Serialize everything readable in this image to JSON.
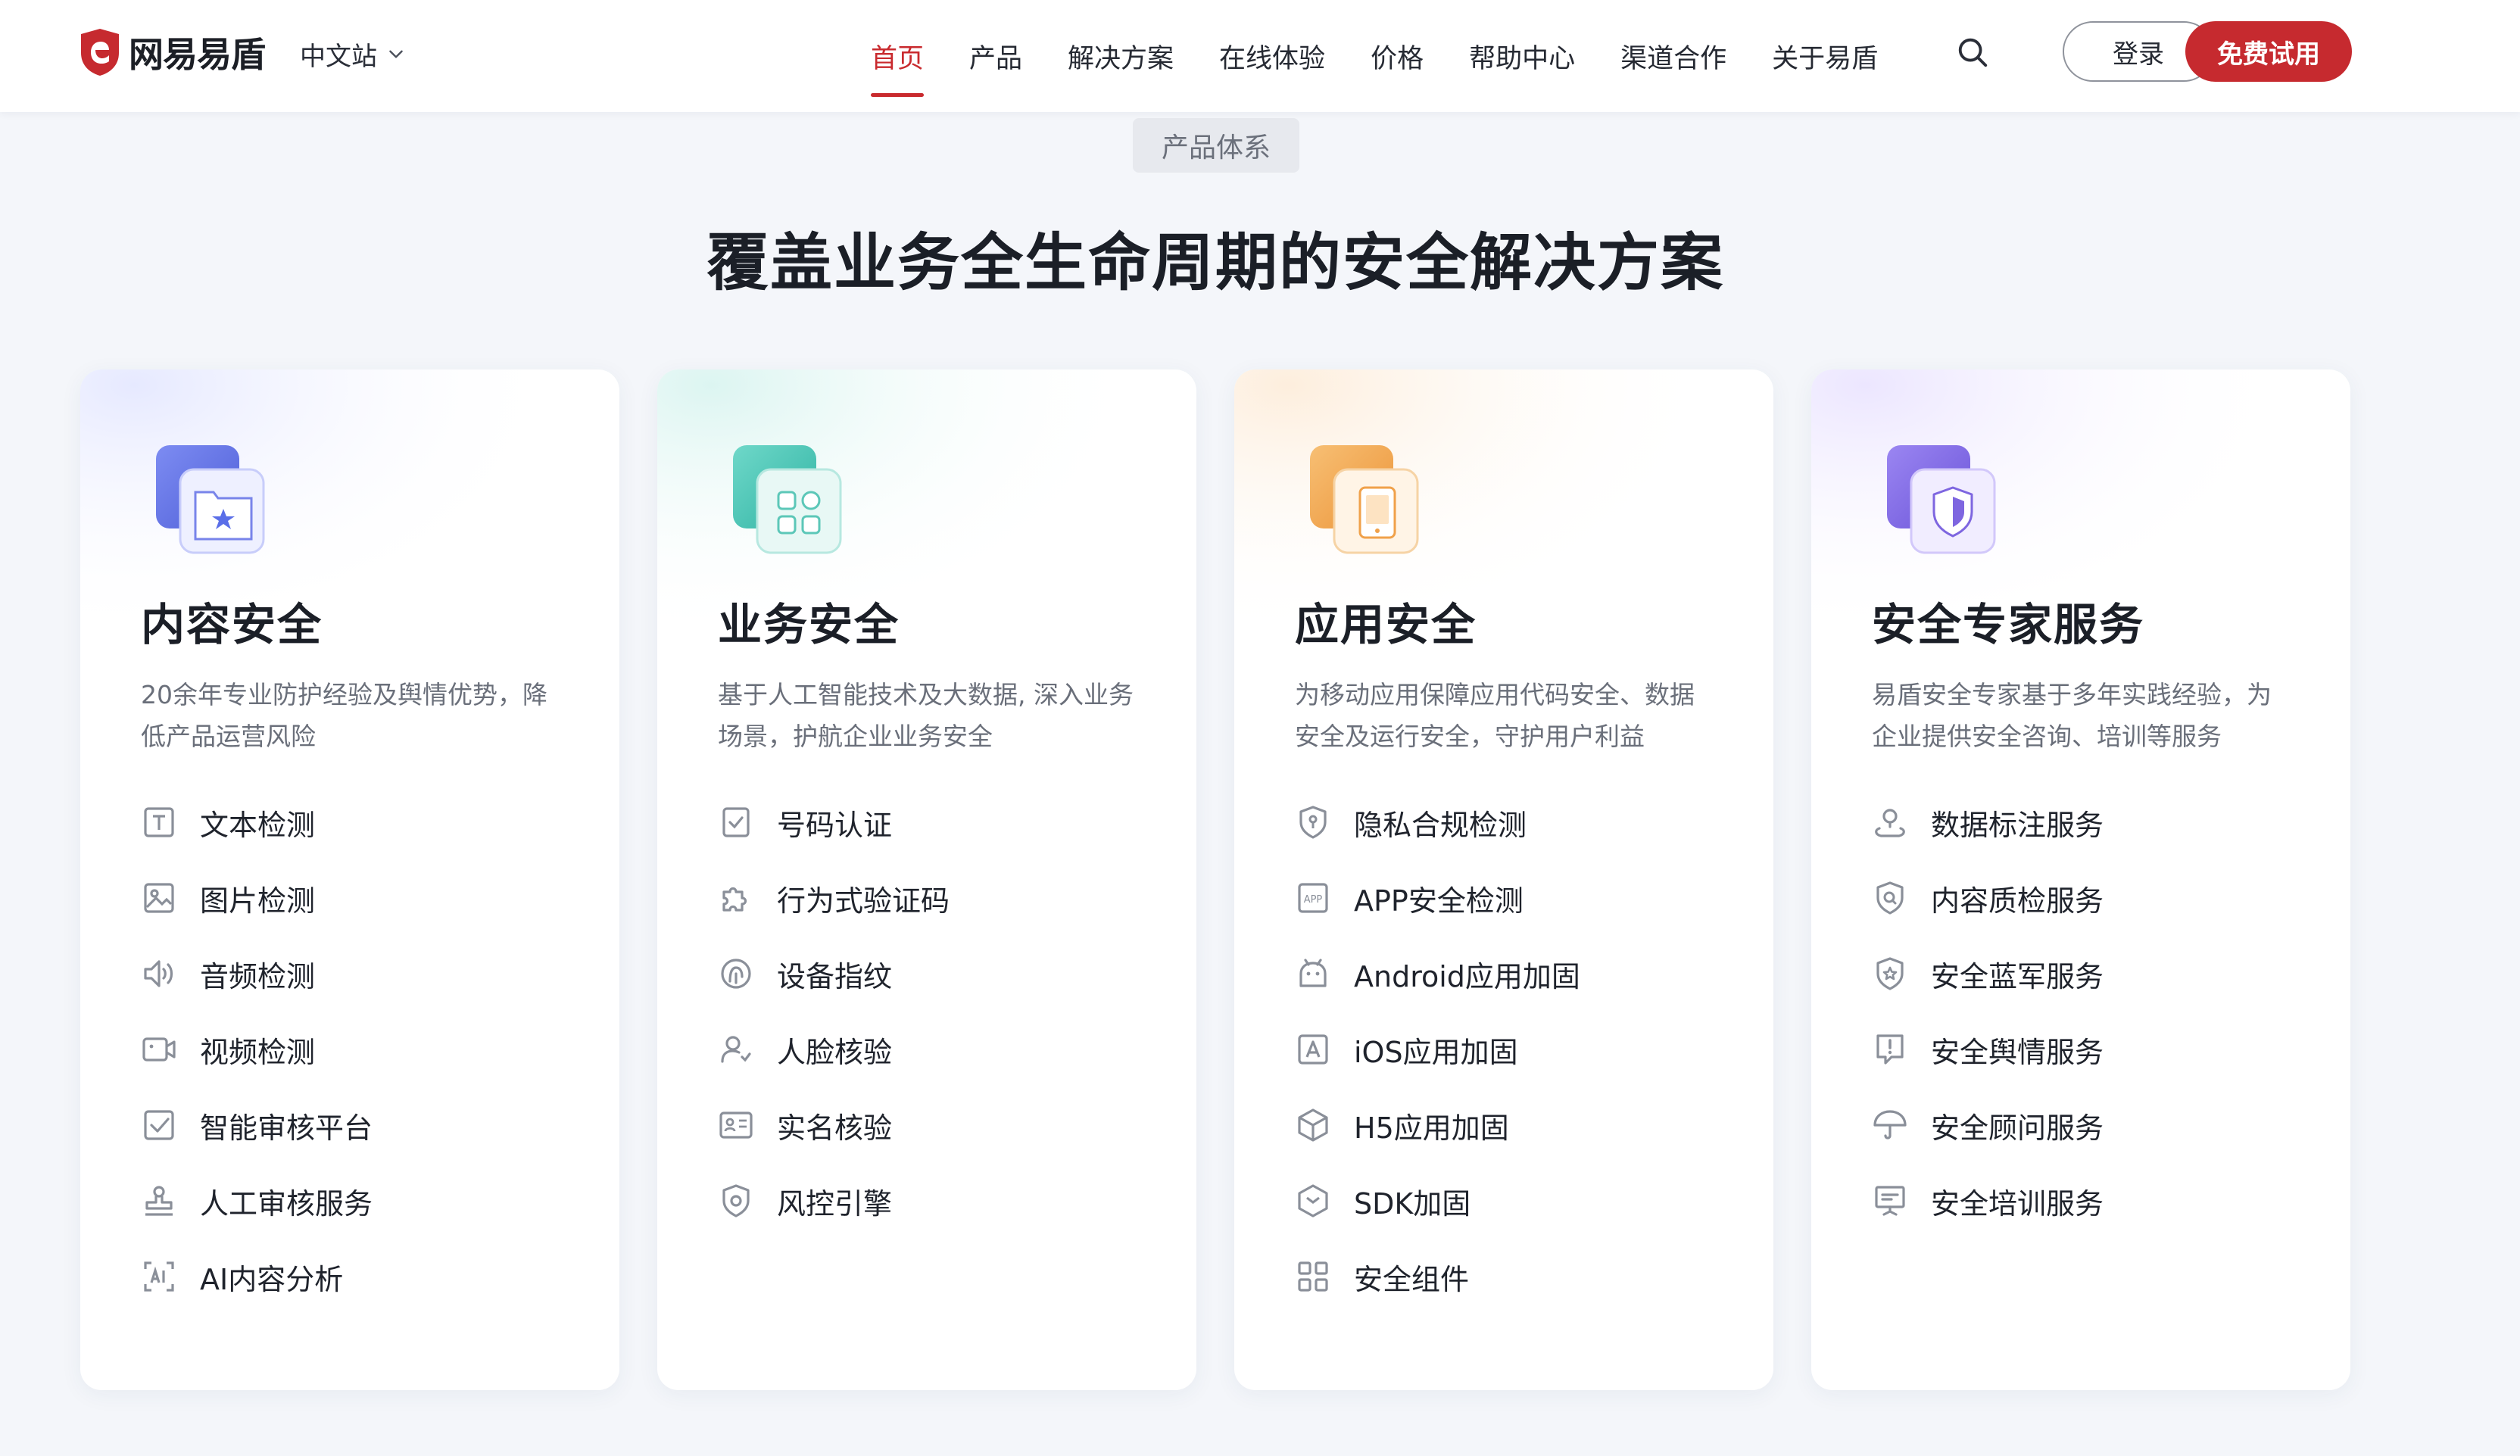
{
  "header": {
    "logo_text": "网易易盾",
    "site_switch": "中文站",
    "nav": [
      "首页",
      "产品",
      "解决方案",
      "在线体验",
      "价格",
      "帮助中心",
      "渠道合作",
      "关于易盾"
    ],
    "active_nav": "首页",
    "login_label": "登录",
    "trial_label": "免费试用"
  },
  "section": {
    "tag": "产品体系",
    "title": "覆盖业务全生命周期的安全解决方案"
  },
  "cards": [
    {
      "title": "内容安全",
      "desc": "20余年专业防护经验及舆情优势，降低产品运营风险",
      "icon": "folder-star-icon",
      "accent": "#5a6ee8",
      "items": [
        {
          "label": "文本检测",
          "icon": "text-icon"
        },
        {
          "label": "图片检测",
          "icon": "image-icon"
        },
        {
          "label": "音频检测",
          "icon": "audio-icon"
        },
        {
          "label": "视频检测",
          "icon": "video-icon"
        },
        {
          "label": "智能审核平台",
          "icon": "check-square-icon"
        },
        {
          "label": "人工审核服务",
          "icon": "stamp-icon"
        },
        {
          "label": "AI内容分析",
          "icon": "ai-scan-icon"
        }
      ]
    },
    {
      "title": "业务安全",
      "desc": "基于人工智能技术及大数据, 深入业务场景，护航企业业务安全",
      "icon": "grid-apps-icon",
      "accent": "#3dbfb0",
      "items": [
        {
          "label": "号码认证",
          "icon": "phone-check-icon"
        },
        {
          "label": "行为式验证码",
          "icon": "puzzle-icon"
        },
        {
          "label": "设备指纹",
          "icon": "fingerprint-icon"
        },
        {
          "label": "人脸核验",
          "icon": "face-user-icon"
        },
        {
          "label": "实名核验",
          "icon": "id-card-icon"
        },
        {
          "label": "风控引擎",
          "icon": "shield-gear-icon"
        }
      ]
    },
    {
      "title": "应用安全",
      "desc": "为移动应用保障应用代码安全、数据安全及运行安全，守护用户利益",
      "icon": "tablet-icon",
      "accent": "#f0a14a",
      "items": [
        {
          "label": "隐私合规检测",
          "icon": "privacy-shield-icon"
        },
        {
          "label": "APP安全检测",
          "icon": "app-icon"
        },
        {
          "label": "Android应用加固",
          "icon": "android-icon"
        },
        {
          "label": "iOS应用加固",
          "icon": "ios-icon"
        },
        {
          "label": "H5应用加固",
          "icon": "cube-icon"
        },
        {
          "label": "SDK加固",
          "icon": "hexagon-icon"
        },
        {
          "label": "安全组件",
          "icon": "components-icon"
        }
      ]
    },
    {
      "title": "安全专家服务",
      "desc": "易盾安全专家基于多年实践经验，为企业提供安全咨询、培训等服务",
      "icon": "shield-icon",
      "accent": "#7e66e0",
      "items": [
        {
          "label": "数据标注服务",
          "icon": "location-user-icon"
        },
        {
          "label": "内容质检服务",
          "icon": "quality-shield-icon"
        },
        {
          "label": "安全蓝军服务",
          "icon": "badge-star-icon"
        },
        {
          "label": "安全舆情服务",
          "icon": "alert-icon"
        },
        {
          "label": "安全顾问服务",
          "icon": "umbrella-icon"
        },
        {
          "label": "安全培训服务",
          "icon": "presentation-icon"
        }
      ]
    }
  ],
  "colors": {
    "brand_red": "#c62a2f",
    "text_dark": "#1b1f27",
    "text_muted": "#6a6f7a",
    "page_bg": "#f4f6fa"
  }
}
